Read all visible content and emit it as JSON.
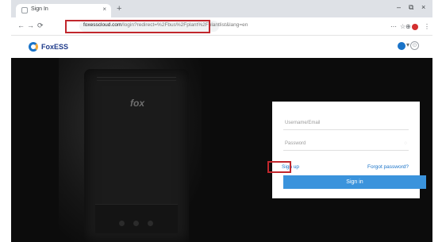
{
  "browser": {
    "tab_title": "Sign In",
    "tab_close": "×",
    "new_tab": "+",
    "window_controls": [
      "–",
      "⧉",
      "×"
    ],
    "nav": [
      "←",
      "→",
      "⟳"
    ],
    "url_domain": "foxesscloud.com",
    "url_path": "/login?redirect=%2Fbus%2Fplant%2Fplantlist&lang=en",
    "toolbar_icons": [
      "⋯",
      "☆",
      "⊕"
    ],
    "menu": "⋮"
  },
  "site": {
    "logo_text": "FoxESS",
    "language_caret": "▾",
    "user_glyph": "⊙"
  },
  "hero": {
    "device_brand": "fox"
  },
  "login": {
    "username_placeholder": "Username/Email",
    "password_placeholder": "Password",
    "eye_glyph": "◌",
    "signup_label": "Sign up",
    "forgot_label": "Forgot password?",
    "signin_label": "Sign in"
  },
  "colors": {
    "accent": "#3a93dc",
    "highlight": "#c1272d",
    "link": "#1a73c8"
  }
}
